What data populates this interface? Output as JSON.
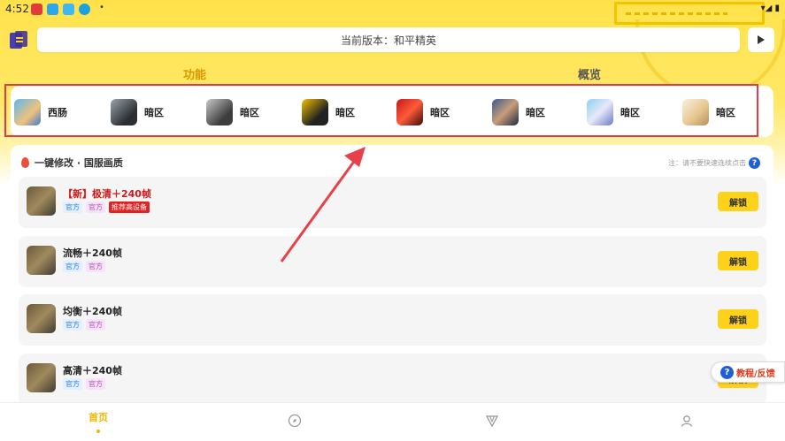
{
  "status_bar": {
    "time": "4:52",
    "dot": "•",
    "icons": "▾◢ ▮"
  },
  "colors": {
    "accent": "#ffd21a",
    "highlight_red": "#e53945",
    "header_yellow": "#ffe24a",
    "tag_red": "#e02222"
  },
  "header": {
    "version_text": "当前版本：和平精英",
    "play_icon": "play-icon"
  },
  "tabs": [
    {
      "label": "功能"
    },
    {
      "label": "概览"
    }
  ],
  "games": [
    {
      "label": "西肠"
    },
    {
      "label": "暗区"
    },
    {
      "label": "暗区"
    },
    {
      "label": "暗区"
    },
    {
      "label": "暗区"
    },
    {
      "label": "暗区"
    },
    {
      "label": "暗区"
    },
    {
      "label": "暗区"
    }
  ],
  "panel": {
    "title": "一键修改 · 国服画质",
    "note": "注：请不要快速连续点击",
    "note_icon": "?"
  },
  "options": [
    {
      "title": "【新】极清＋240帧",
      "tags": [
        "官方",
        "官方"
      ],
      "hot_tag": "推荐高设备",
      "button": "解锁"
    },
    {
      "title": "流畅＋240帧",
      "tags": [
        "官方",
        "官方"
      ],
      "button": "解锁"
    },
    {
      "title": "均衡＋240帧",
      "tags": [
        "官方",
        "官方"
      ],
      "button": "解锁"
    },
    {
      "title": "高清＋240帧",
      "tags": [
        "官方",
        "官方"
      ],
      "button": "解锁"
    }
  ],
  "feedback": {
    "icon": "?",
    "label": "教程/反馈"
  },
  "bottom_nav": {
    "home": "首页",
    "icons": [
      "compass-icon",
      "triangle-icon",
      "user-icon"
    ]
  }
}
